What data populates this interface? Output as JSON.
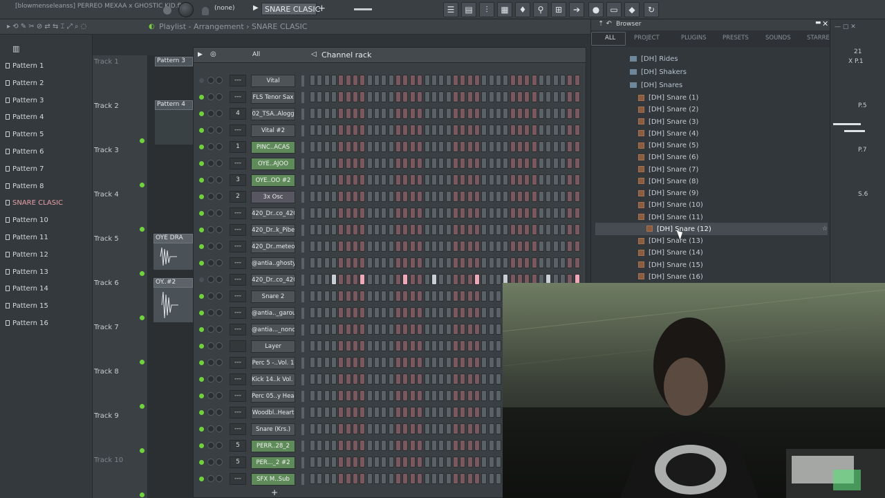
{
  "topbar": {
    "project_title": "[blowmenseleanss] PERREO MEXAA x GHOSTIC KID.flp",
    "none_label": "(none)",
    "pattern_name": "SNARE CLASIC",
    "add_symbol": "+"
  },
  "playlist": {
    "title": "Playlist - Arrangement › SNARE CLASIC",
    "patterns": [
      "Pattern 1",
      "Pattern 2",
      "Pattern 3",
      "Pattern 4",
      "Pattern 5",
      "Pattern 6",
      "Pattern 7",
      "Pattern 8",
      "SNARE CLASIC",
      "Pattern 10",
      "Pattern 11",
      "Pattern 12",
      "Pattern 13",
      "Pattern 14",
      "Pattern 15",
      "Pattern 16"
    ],
    "tracks": [
      "Track 1",
      "Track 2",
      "Track 3",
      "Track 4",
      "Track 5",
      "Track 6",
      "Track 7",
      "Track 8",
      "Track 9",
      "Track 10"
    ],
    "clips": {
      "c1": "Pattern 3",
      "c2": "Pattern 4",
      "c3": "OYE DRA",
      "c4": "OY..#2"
    }
  },
  "channel_rack": {
    "title": "Channel rack",
    "filter": "All",
    "channels": [
      {
        "mix": "---",
        "name": "Vital",
        "style": "gray",
        "led": false,
        "steps": ""
      },
      {
        "mix": "---",
        "name": "FLS Tenor Sax",
        "style": "gray",
        "led": true,
        "steps": ""
      },
      {
        "mix": "4",
        "name": "02_TSA..Alogg",
        "style": "gray",
        "led": true,
        "steps": ""
      },
      {
        "mix": "---",
        "name": "Vital #2",
        "style": "gray",
        "led": true,
        "steps": ""
      },
      {
        "mix": "1",
        "name": "PINC..ACAS",
        "style": "green",
        "led": true,
        "steps": ""
      },
      {
        "mix": "---",
        "name": "OYE..AJOO",
        "style": "green",
        "led": true,
        "steps": ""
      },
      {
        "mix": "3",
        "name": "OYE..OO #2",
        "style": "green",
        "led": true,
        "steps": ""
      },
      {
        "mix": "2",
        "name": "3x Osc",
        "style": "pink",
        "led": true,
        "steps": ""
      },
      {
        "mix": "---",
        "name": "420_Dr..co_420",
        "style": "gray",
        "led": true,
        "steps": ""
      },
      {
        "mix": "---",
        "name": "420_Dr..k_Pibe",
        "style": "gray",
        "led": true,
        "steps": ""
      },
      {
        "mix": "---",
        "name": "420_Dr..meteo",
        "style": "gray",
        "led": true,
        "steps": ""
      },
      {
        "mix": "---",
        "name": "@antia..ghosty",
        "style": "gray",
        "led": true,
        "steps": ""
      },
      {
        "mix": "---",
        "name": "420_Dr..co_420",
        "style": "gray",
        "led": false,
        "steps": "4,8,14,18,24,28,34,38"
      },
      {
        "mix": "---",
        "name": "Snare 2",
        "style": "gray",
        "led": true,
        "steps": ""
      },
      {
        "mix": "---",
        "name": "@antia.._garou",
        "style": "gray",
        "led": true,
        "steps": ""
      },
      {
        "mix": "---",
        "name": "@antia..._nono",
        "style": "gray",
        "led": true,
        "steps": ""
      },
      {
        "mix": "",
        "name": "Layer",
        "style": "gray",
        "led": true,
        "steps": ""
      },
      {
        "mix": "---",
        "name": "Perc 5 -..Vol. 1",
        "style": "gray",
        "led": true,
        "steps": ""
      },
      {
        "mix": "---",
        "name": "Kick 14..k Vol. 1",
        "style": "gray",
        "led": true,
        "steps": ""
      },
      {
        "mix": "---",
        "name": "Perc 05..y Heart",
        "style": "gray",
        "led": true,
        "steps": ""
      },
      {
        "mix": "---",
        "name": "Woodbl..Heart",
        "style": "gray",
        "led": true,
        "steps": ""
      },
      {
        "mix": "---",
        "name": "Snare (Krs.)",
        "style": "gray",
        "led": true,
        "steps": ""
      },
      {
        "mix": "5",
        "name": "PERR..28_2",
        "style": "green",
        "led": true,
        "steps": ""
      },
      {
        "mix": "5",
        "name": "PER..._2 #2",
        "style": "green",
        "led": true,
        "steps": ""
      },
      {
        "mix": "---",
        "name": "SFX M..Sub",
        "style": "green",
        "led": true,
        "steps": ""
      }
    ]
  },
  "browser": {
    "title": "Browser",
    "tabs": [
      "ALL",
      "PROJECT",
      "PLUGINS",
      "PRESETS",
      "SOUNDS",
      "STARRED"
    ],
    "folders": [
      "[DH] Rides",
      "[DH] Shakers",
      "[DH] Snares"
    ],
    "items": [
      "[DH] Snare (1)",
      "[DH] Snare (2)",
      "[DH] Snare (3)",
      "[DH] Snare (4)",
      "[DH] Snare (5)",
      "[DH] Snare (6)",
      "[DH] Snare (7)",
      "[DH] Snare (8)",
      "[DH] Snare (9)",
      "[DH] Snare (10)",
      "[DH] Snare (11)",
      "[DH] Snare (12)",
      "[DH] Snare (13)",
      "[DH] Snare (14)",
      "[DH] Snare (15)",
      "[DH] Snare (16)"
    ],
    "selected_index": 11
  },
  "right_panel": {
    "number": "21",
    "labels": [
      "X P.1",
      "P.5",
      "P.7",
      "S.6"
    ]
  },
  "colors": {
    "led_green": "#6fd43a",
    "accent_pink": "#f0a8b6",
    "step_red": "#7a585e",
    "folder_blue": "#6f879a"
  }
}
